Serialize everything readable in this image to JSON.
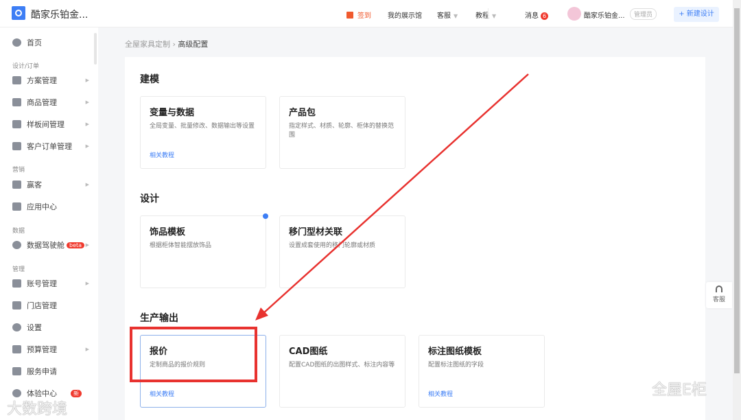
{
  "header": {
    "brand": "酷家乐铂金...",
    "checkin": "签到",
    "showroom": "我的展示馆",
    "service": "客服",
    "tutorial": "教程",
    "messages": "消息",
    "message_count": "6",
    "user": "酷家乐铂金...",
    "role": "管理员",
    "new_design": "+ 新建设计"
  },
  "sidebar": {
    "home": "首页",
    "groups": [
      "设计/订单",
      "营销",
      "数据",
      "管理"
    ],
    "items": [
      "方案管理",
      "商品管理",
      "样板间管理",
      "客户订单管理",
      "赢客",
      "应用中心",
      "数据驾驶舱",
      "账号管理",
      "门店管理",
      "设置",
      "预算管理",
      "服务申请",
      "体验中心"
    ],
    "beta": "beta",
    "new_badge": "新"
  },
  "breadcrumb": {
    "parent": "全屋家具定制",
    "current": "高级配置"
  },
  "sections": [
    {
      "title": "建模",
      "cards": [
        {
          "title": "变量与数据",
          "desc": "全局变量、批量修改、数据输出等设置",
          "link": "相关教程"
        },
        {
          "title": "产品包",
          "desc": "指定样式、材质、轮廓、柜体的替换范围"
        }
      ]
    },
    {
      "title": "设计",
      "cards": [
        {
          "title": "饰品模板",
          "desc": "根据柜体智能摆放饰品"
        },
        {
          "title": "移门型材关联",
          "desc": "设置成套使用的移门轮廓或材质"
        }
      ]
    },
    {
      "title": "生产输出",
      "cards": [
        {
          "title": "报价",
          "desc": "定制商品的报价规则",
          "link": "相关教程"
        },
        {
          "title": "CAD图纸",
          "desc": "配置CAD图纸的出图样式、标注内容等"
        },
        {
          "title": "标注图纸模板",
          "desc": "配置标注图纸的字段",
          "link": "相关教程"
        }
      ]
    }
  ],
  "float_service": "客服",
  "watermarks": {
    "left": "大数跨境",
    "right": "全屋E柜"
  },
  "colors": {
    "accent": "#3d7ef5",
    "annotation": "#e8322f",
    "badge": "#f03a2e"
  }
}
